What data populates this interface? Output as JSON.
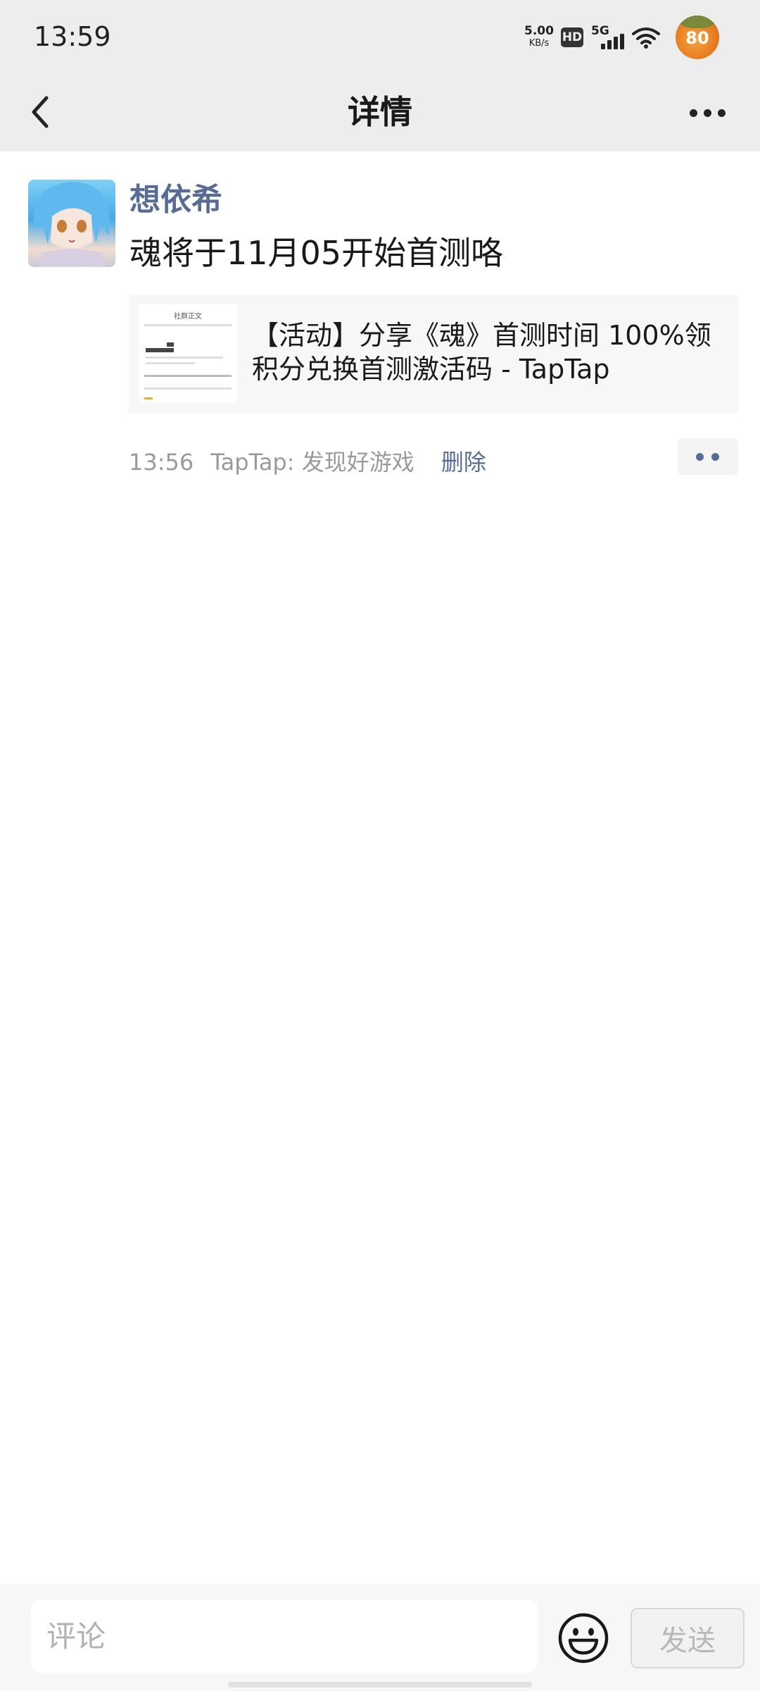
{
  "status_bar": {
    "time": "13:59",
    "net_speed_value": "5.00",
    "net_speed_unit": "KB/s",
    "hd_label": "HD",
    "network_label": "5G",
    "battery_level": "80",
    "icons": [
      "hd-icon",
      "signal-icon",
      "wifi-icon",
      "battery-avatar-icon"
    ]
  },
  "nav": {
    "title": "详情",
    "back_icon": "chevron-left-icon",
    "more_icon": "more-dots-icon"
  },
  "post": {
    "author": "想依希",
    "text": "魂将于11月05开始首测咯",
    "link_card": {
      "title": "【活动】分享《魂》首测时间 100%领积分兑换首测激活码 - TapTap",
      "thumb_title": "社群正文"
    },
    "time": "13:56",
    "source": "TapTap: 发现好游戏",
    "delete_label": "删除"
  },
  "comment_bar": {
    "placeholder": "评论",
    "value": "",
    "send_label": "发送",
    "emoji_icon": "smiley-icon"
  },
  "colors": {
    "link_blue": "#576b95",
    "bar_gray": "#ededed",
    "text_dark": "#191919",
    "meta_gray": "#9a9a9a"
  }
}
